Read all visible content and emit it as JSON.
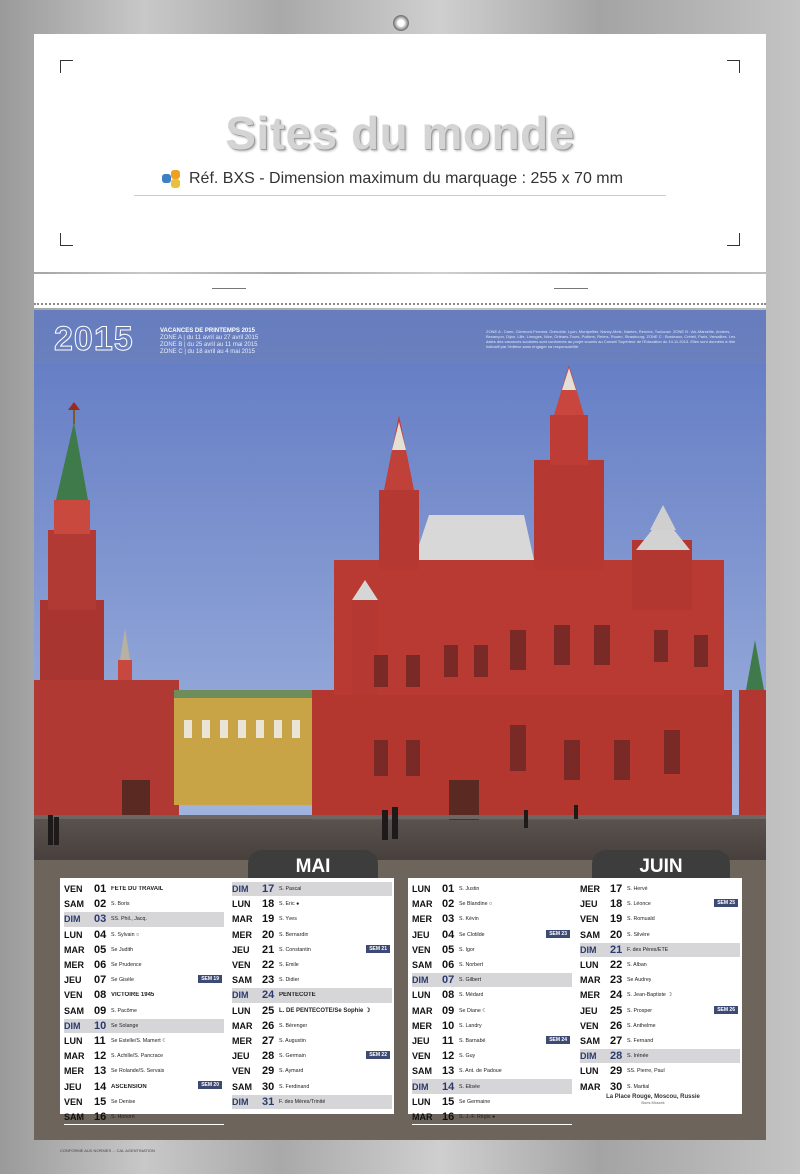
{
  "header": {
    "title": "Sites du monde",
    "ref": "Réf. BXS - Dimension maximum du marquage : 255 x 70 mm"
  },
  "photo": {
    "year": "2015",
    "vacances_title": "VACANCES DE PRINTEMPS 2015",
    "vacances_lines": [
      "ZONE A  | du 11 avril au 27 avril 2015",
      "ZONE B  | du 25 avril au 11 mai 2015",
      "ZONE C  | du 18 avril au 4 mai 2015"
    ],
    "zone_note": "ZONE A : Caen, Clermont-Ferrand, Grenoble, Lyon, Montpellier, Nancy-Metz, Nantes, Rennes, Toulouse. ZONE B : Aix-Marseille, Amiens, Besançon, Dijon, Lille, Limoges, Nice, Orléans-Tours, Poitiers, Reims, Rouen, Strasbourg. ZONE C : Bordeaux, Créteil, Paris, Versailles. Les dates des vacances scolaires sont conformes au projet soumis au Conseil Supérieur de l'Education du 14.11.2013. Elles sont données à titre indicatif par l'éditeur sans engager sa responsabilité."
  },
  "months": [
    {
      "name": "MAI",
      "columns": [
        [
          {
            "wd": "VEN",
            "d": "01",
            "n": "FÊTE DU TRAVAIL",
            "b": true
          },
          {
            "wd": "SAM",
            "d": "02",
            "n": "S. Boris"
          },
          {
            "wd": "DIM",
            "d": "03",
            "n": "SS. Phil., Jacq.",
            "hl": true
          },
          {
            "wd": "LUN",
            "d": "04",
            "n": "S. Sylvain  ○"
          },
          {
            "wd": "MAR",
            "d": "05",
            "n": "Se Judith"
          },
          {
            "wd": "MER",
            "d": "06",
            "n": "Se Prudence"
          },
          {
            "wd": "JEU",
            "d": "07",
            "n": "Se Gisèle",
            "wk": "SEM 19"
          },
          {
            "wd": "VEN",
            "d": "08",
            "n": "VICTOIRE 1945",
            "b": true
          },
          {
            "wd": "SAM",
            "d": "09",
            "n": "S. Pacôme"
          },
          {
            "wd": "DIM",
            "d": "10",
            "n": "Se Solange",
            "hl": true
          },
          {
            "wd": "LUN",
            "d": "11",
            "n": "Se Estelle/S. Mamert  ☾"
          },
          {
            "wd": "MAR",
            "d": "12",
            "n": "S. Achille/S. Pancrace"
          },
          {
            "wd": "MER",
            "d": "13",
            "n": "Se Rolande/S. Servais"
          },
          {
            "wd": "JEU",
            "d": "14",
            "n": "ASCENSION",
            "b": true,
            "wk": "SEM 20"
          },
          {
            "wd": "VEN",
            "d": "15",
            "n": "Se Denise"
          },
          {
            "wd": "SAM",
            "d": "16",
            "n": "S. Honoré"
          }
        ],
        [
          {
            "wd": "DIM",
            "d": "17",
            "n": "S. Pascal",
            "hl": true
          },
          {
            "wd": "LUN",
            "d": "18",
            "n": "S. Eric  ●"
          },
          {
            "wd": "MAR",
            "d": "19",
            "n": "S. Yves"
          },
          {
            "wd": "MER",
            "d": "20",
            "n": "S. Bernardin"
          },
          {
            "wd": "JEU",
            "d": "21",
            "n": "S. Constantin",
            "wk": "SEM 21"
          },
          {
            "wd": "VEN",
            "d": "22",
            "n": "S. Emile"
          },
          {
            "wd": "SAM",
            "d": "23",
            "n": "S. Didier"
          },
          {
            "wd": "DIM",
            "d": "24",
            "n": "PENTECÔTE",
            "b": true,
            "hl": true
          },
          {
            "wd": "LUN",
            "d": "25",
            "n": "L. DE PENTECÔTE/Se Sophie  ☽",
            "b": true
          },
          {
            "wd": "MAR",
            "d": "26",
            "n": "S. Bérenger"
          },
          {
            "wd": "MER",
            "d": "27",
            "n": "S. Augustin"
          },
          {
            "wd": "JEU",
            "d": "28",
            "n": "S. Germain",
            "wk": "SEM 22"
          },
          {
            "wd": "VEN",
            "d": "29",
            "n": "S. Aymard"
          },
          {
            "wd": "SAM",
            "d": "30",
            "n": "S. Ferdinand"
          },
          {
            "wd": "DIM",
            "d": "31",
            "n": "F. des Mères/Trinité",
            "hl": true
          }
        ]
      ]
    },
    {
      "name": "JUIN",
      "columns": [
        [
          {
            "wd": "LUN",
            "d": "01",
            "n": "S. Justin"
          },
          {
            "wd": "MAR",
            "d": "02",
            "n": "Se Blandine  ○"
          },
          {
            "wd": "MER",
            "d": "03",
            "n": "S. Kévin"
          },
          {
            "wd": "JEU",
            "d": "04",
            "n": "Se Clotilde",
            "wk": "SEM 23"
          },
          {
            "wd": "VEN",
            "d": "05",
            "n": "S. Igor"
          },
          {
            "wd": "SAM",
            "d": "06",
            "n": "S. Norbert"
          },
          {
            "wd": "DIM",
            "d": "07",
            "n": "S. Gilbert",
            "hl": true
          },
          {
            "wd": "LUN",
            "d": "08",
            "n": "S. Médard"
          },
          {
            "wd": "MAR",
            "d": "09",
            "n": "Se Diane  ☾"
          },
          {
            "wd": "MER",
            "d": "10",
            "n": "S. Landry"
          },
          {
            "wd": "JEU",
            "d": "11",
            "n": "S. Barnabé",
            "wk": "SEM 24"
          },
          {
            "wd": "VEN",
            "d": "12",
            "n": "S. Guy"
          },
          {
            "wd": "SAM",
            "d": "13",
            "n": "S. Ant. de Padoue"
          },
          {
            "wd": "DIM",
            "d": "14",
            "n": "S. Elisée",
            "hl": true
          },
          {
            "wd": "LUN",
            "d": "15",
            "n": "Se Germaine"
          },
          {
            "wd": "MAR",
            "d": "16",
            "n": "S. J.-F. Régis  ●"
          }
        ],
        [
          {
            "wd": "MER",
            "d": "17",
            "n": "S. Hervé"
          },
          {
            "wd": "JEU",
            "d": "18",
            "n": "S. Léonce",
            "wk": "SEM 25"
          },
          {
            "wd": "VEN",
            "d": "19",
            "n": "S. Romuald"
          },
          {
            "wd": "SAM",
            "d": "20",
            "n": "S. Silvère"
          },
          {
            "wd": "DIM",
            "d": "21",
            "n": "F. des Pères/ÉTÉ",
            "hl": true
          },
          {
            "wd": "LUN",
            "d": "22",
            "n": "S. Alban"
          },
          {
            "wd": "MAR",
            "d": "23",
            "n": "Se Audrey"
          },
          {
            "wd": "MER",
            "d": "24",
            "n": "S. Jean-Baptiste  ☽"
          },
          {
            "wd": "JEU",
            "d": "25",
            "n": "S. Prosper",
            "wk": "SEM 26"
          },
          {
            "wd": "VEN",
            "d": "26",
            "n": "S. Anthelme"
          },
          {
            "wd": "SAM",
            "d": "27",
            "n": "S. Fernand"
          },
          {
            "wd": "DIM",
            "d": "28",
            "n": "S. Irénée",
            "hl": true
          },
          {
            "wd": "LUN",
            "d": "29",
            "n": "SS. Pierre, Paul"
          },
          {
            "wd": "MAR",
            "d": "30",
            "n": "S. Martial"
          }
        ]
      ]
    }
  ],
  "caption": {
    "title": "La Place Rouge, Moscou, Russie",
    "credit": "Boris Mrazek"
  },
  "footer": "CONFORME AUX NORMES ... CAL AGENTINATION",
  "colors": {
    "board": "#6d645b",
    "tab": "#3d3d3d",
    "highlight_row": "#d6d6d9",
    "week_badge": "#3d4a73",
    "sky": "#6f85c6",
    "brick": "#b13a34"
  }
}
